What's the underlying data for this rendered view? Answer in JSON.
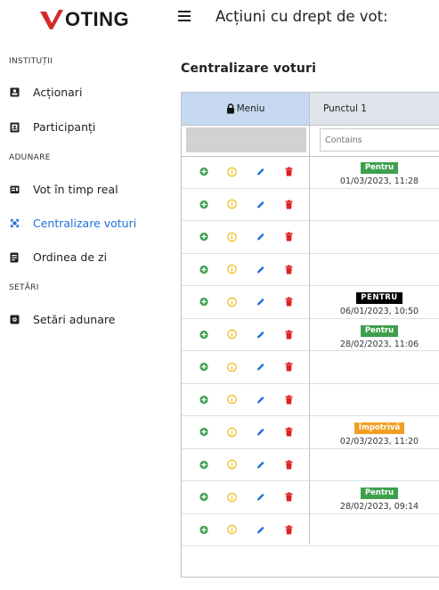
{
  "app": {
    "logo_rest": "OTING",
    "logo_letter": "V",
    "colors": {
      "logo_v": "#d42a2a",
      "accent": "#1e6fd9",
      "pentru": "#3ea04e",
      "impotriva": "#f0a020"
    }
  },
  "sidebar": {
    "sections": [
      "INSTITUȚII",
      "ADUNARE",
      "SETĂRI"
    ],
    "items": [
      {
        "label": "Acționari",
        "icon": "id-badge-icon"
      },
      {
        "label": "Participanți",
        "icon": "contacts-book-icon"
      },
      {
        "label": "Vot în timp real",
        "icon": "realtime-vote-icon"
      },
      {
        "label": "Centralizare voturi",
        "icon": "aggregate-icon"
      },
      {
        "label": "Ordinea de zi",
        "icon": "document-icon"
      },
      {
        "label": "Setări adunare",
        "icon": "settings-box-icon"
      }
    ],
    "active_item": "Centralizare voturi"
  },
  "header": {
    "title": "Acțiuni cu drept de vot:",
    "menu_icon": "hamburger-icon"
  },
  "main": {
    "title": "Centralizare voturi",
    "grid": {
      "columns": [
        "Meniu",
        "Punctul 1"
      ],
      "filter_placeholder": "Contains",
      "rows": [
        {
          "vote": "Pentru",
          "date": "01/03/2023, 11:28",
          "style": "pentru"
        },
        {
          "vote": "",
          "date": "",
          "style": ""
        },
        {
          "vote": "",
          "date": "",
          "style": ""
        },
        {
          "vote": "",
          "date": "",
          "style": ""
        },
        {
          "vote": "PENTRU",
          "date": "06/01/2023, 10:50",
          "style": "pentru-up"
        },
        {
          "vote": "Pentru",
          "date": "28/02/2023, 11:06",
          "style": "pentru"
        },
        {
          "vote": "",
          "date": "",
          "style": ""
        },
        {
          "vote": "",
          "date": "",
          "style": ""
        },
        {
          "vote": "Împotrivă",
          "date": "02/03/2023, 11:20",
          "style": "impotriva"
        },
        {
          "vote": "",
          "date": "",
          "style": ""
        },
        {
          "vote": "Pentru",
          "date": "28/02/2023, 09:14",
          "style": "pentru"
        },
        {
          "vote": "",
          "date": "",
          "style": ""
        }
      ],
      "row_actions": [
        "add-circle-icon",
        "info-icon",
        "edit-pencil-icon",
        "delete-trash-icon"
      ]
    }
  }
}
